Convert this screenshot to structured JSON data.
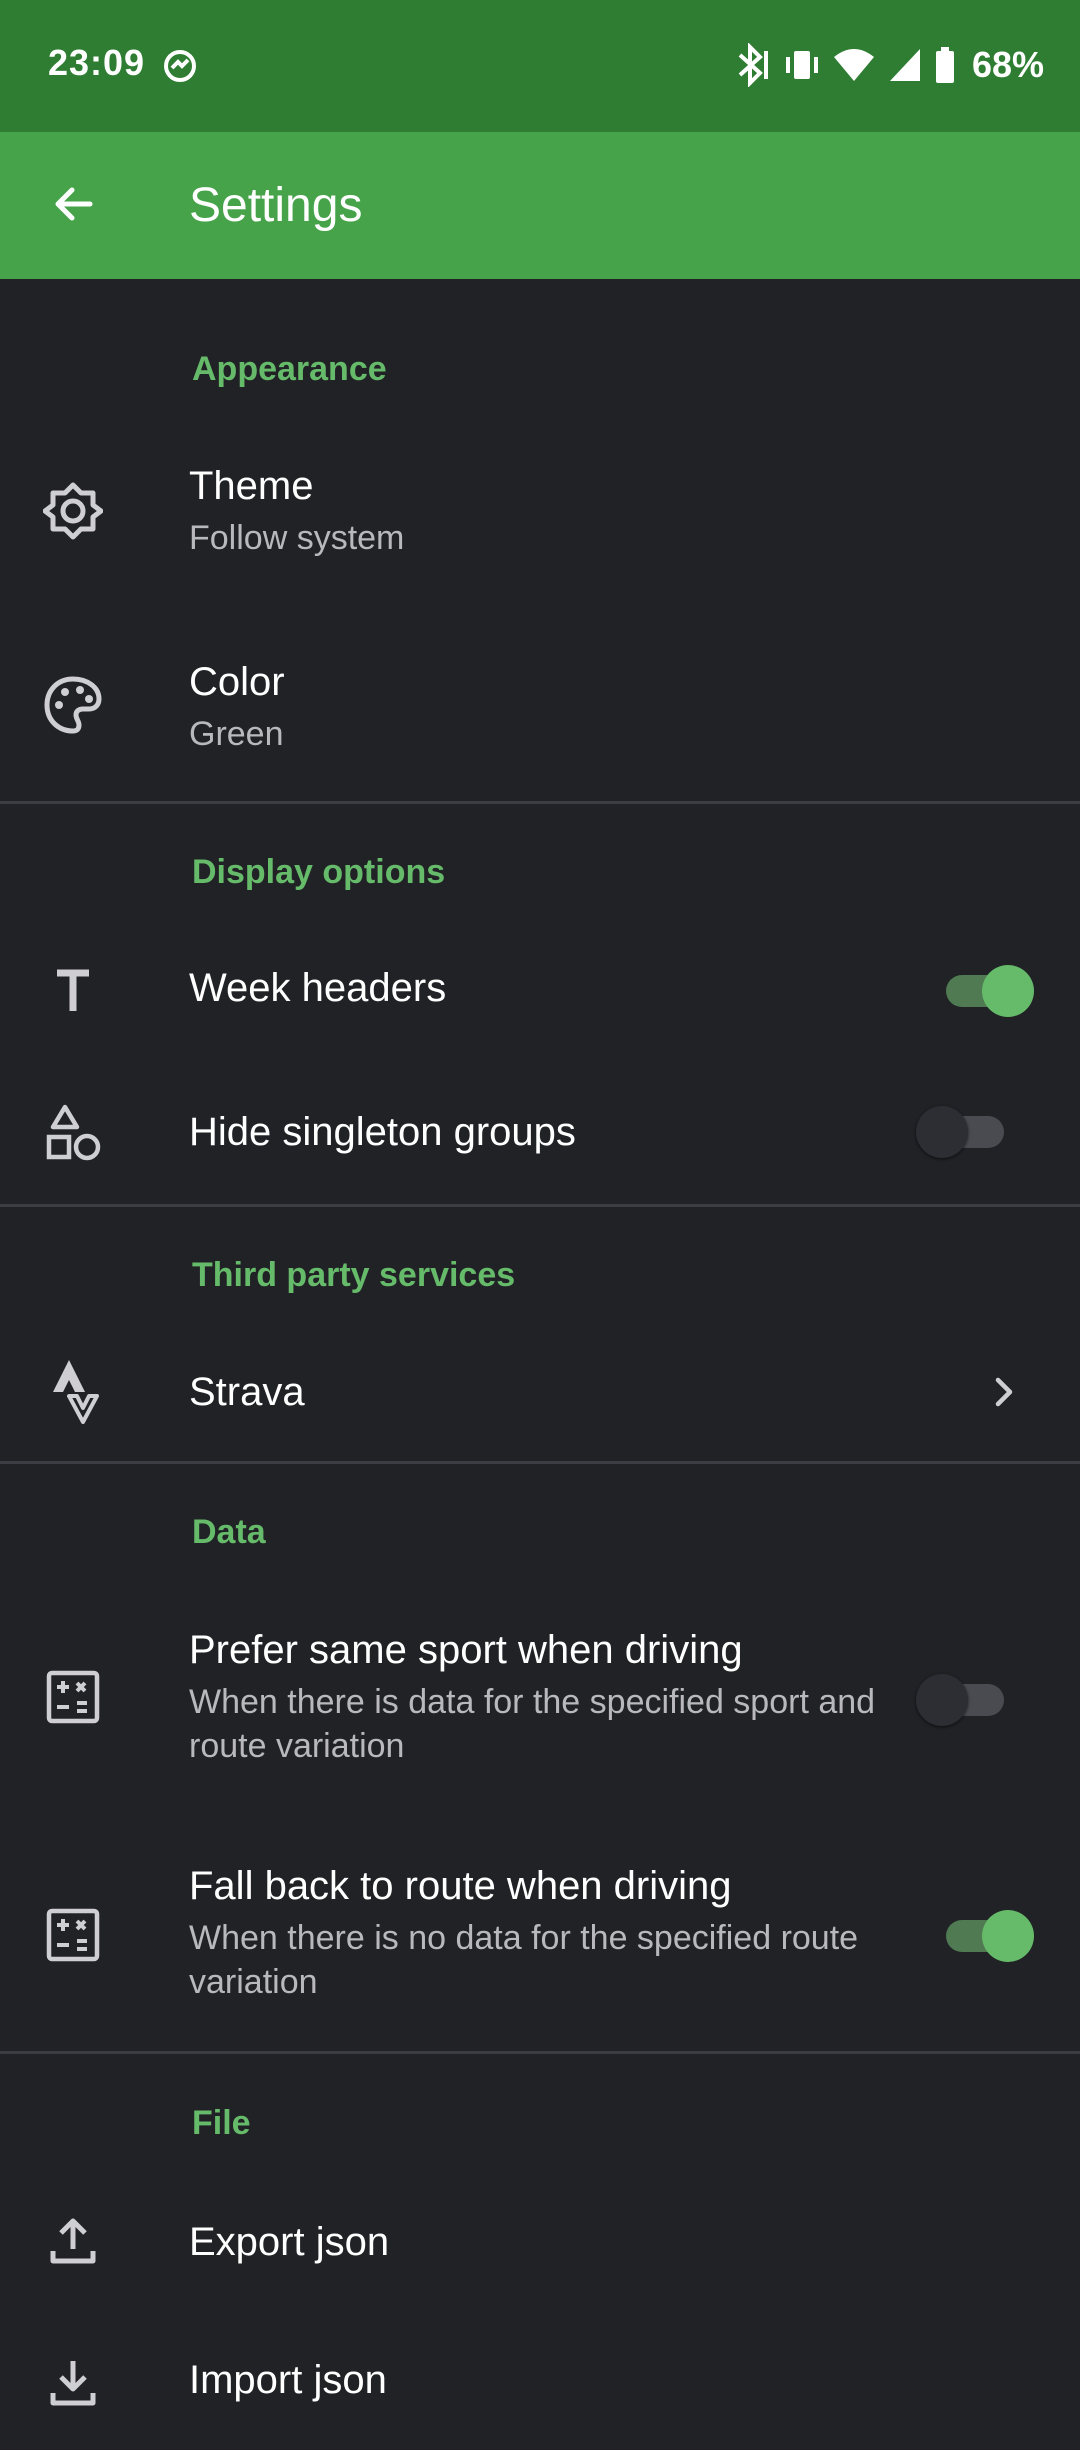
{
  "status_bar": {
    "time": "23:09",
    "battery_percent": "68%",
    "icons": [
      "sync-icon",
      "bluetooth-icon",
      "vibrate-icon",
      "wifi-icon",
      "cell-signal-icon",
      "battery-icon"
    ]
  },
  "app_bar": {
    "title": "Settings",
    "back_icon": "arrow-back-icon"
  },
  "colors": {
    "status_bar": "#2e7d32",
    "app_bar": "#46a34a",
    "accent": "#66bb6a",
    "background": "#212226"
  },
  "sections": {
    "appearance": {
      "header": "Appearance",
      "theme": {
        "title": "Theme",
        "subtitle": "Follow system",
        "icon": "theme-icon"
      },
      "color": {
        "title": "Color",
        "subtitle": "Green",
        "icon": "palette-icon"
      }
    },
    "display": {
      "header": "Display options",
      "week_headers": {
        "title": "Week headers",
        "icon": "text-icon",
        "enabled": true
      },
      "hide_singleton": {
        "title": "Hide singleton groups",
        "icon": "shapes-icon",
        "enabled": false
      }
    },
    "third_party": {
      "header": "Third party services",
      "strava": {
        "title": "Strava",
        "icon": "strava-icon"
      }
    },
    "data": {
      "header": "Data",
      "prefer_same_sport": {
        "title": "Prefer same sport when driving",
        "subtitle": "When there is data for the specified sport and route variation",
        "icon": "calculator-icon",
        "enabled": false
      },
      "fall_back": {
        "title": "Fall back to route when driving",
        "subtitle": "When there is no data for the specified route variation",
        "icon": "calculator-icon",
        "enabled": true
      }
    },
    "file": {
      "header": "File",
      "export": {
        "title": "Export json",
        "icon": "upload-icon"
      },
      "import": {
        "title": "Import json",
        "icon": "download-icon"
      }
    }
  }
}
